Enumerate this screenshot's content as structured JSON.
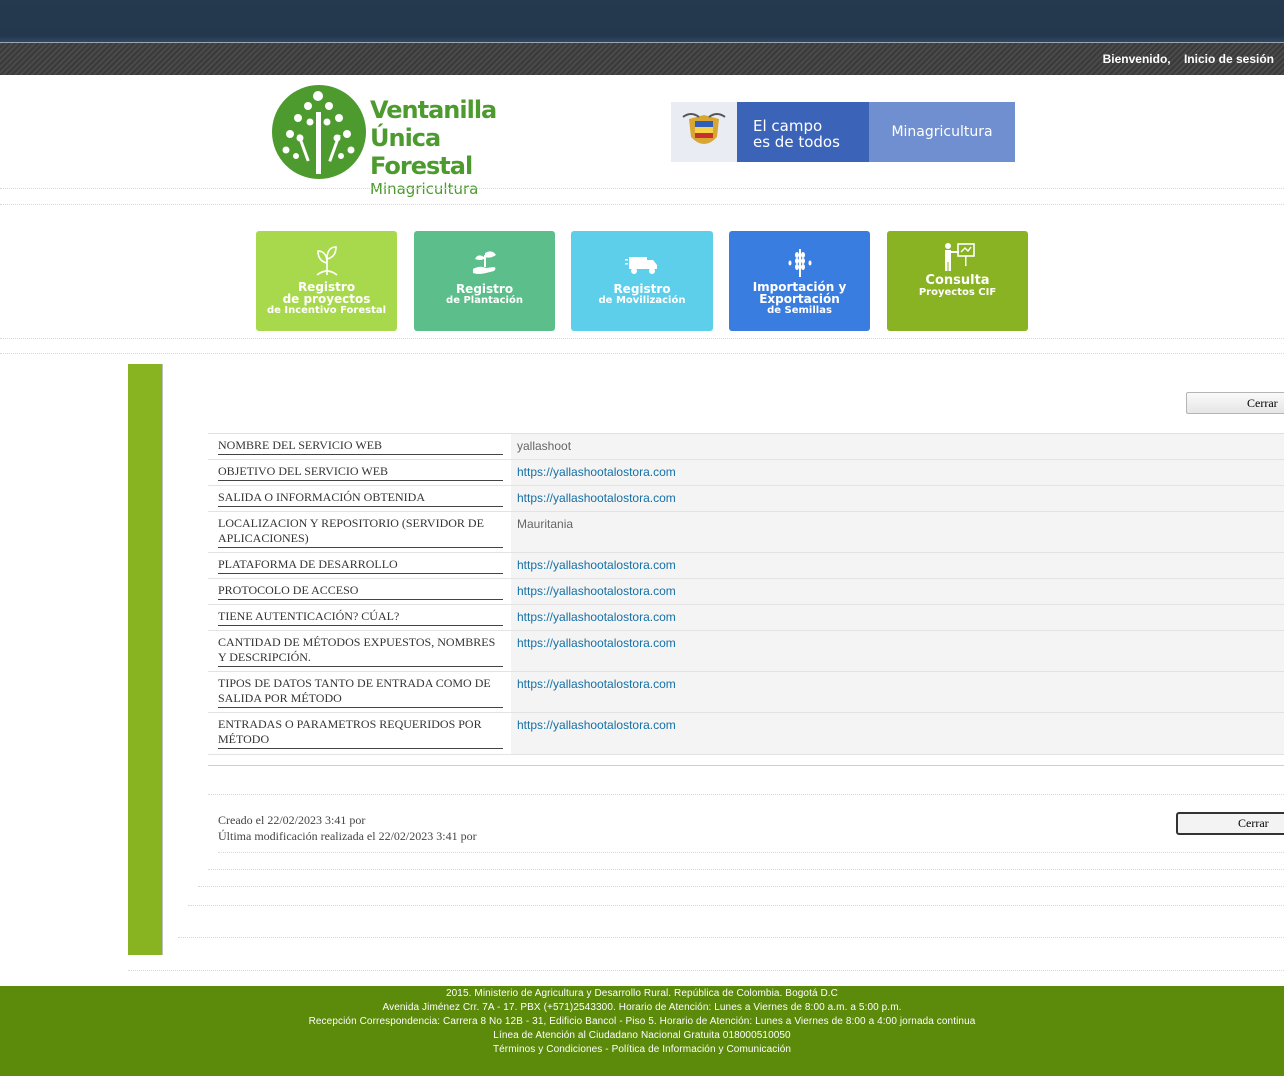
{
  "header": {
    "welcome": "Bienvenido,",
    "login": "Inicio de sesión"
  },
  "logo": {
    "line1": "Ventanilla",
    "line2": "Única Forestal",
    "line3": "Minagricultura"
  },
  "gov_banner": {
    "campo_line1": "El campo",
    "campo_line2": "es de todos",
    "ministry": "Minagricultura"
  },
  "tiles": [
    {
      "l1": "Registro",
      "l2": "de proyectos",
      "l3": "de Incentivo Forestal",
      "color": "#a8d94c"
    },
    {
      "l1": "Registro",
      "l2": "de Plantación",
      "l3": "",
      "color": "#5cbf8b"
    },
    {
      "l1": "Registro",
      "l2": "de Movilización",
      "l3": "",
      "color": "#5dcfea"
    },
    {
      "l1": "Importación y",
      "l2": "Exportación",
      "l3": "de Semillas",
      "color": "#3a7de0"
    },
    {
      "l1": "Consulta",
      "l2": "Proyectos CIF",
      "l3": "",
      "color": "#8ab324"
    }
  ],
  "buttons": {
    "close_top": "Cerrar",
    "close_bottom": "Cerrar"
  },
  "form": {
    "rows": [
      {
        "label": "NOMBRE DEL SERVICIO WEB",
        "value": "yallashoot"
      },
      {
        "label": "OBJETIVO DEL SERVICIO WEB",
        "value": "https://yallashootalostora.com"
      },
      {
        "label": "SALIDA O INFORMACIÓN OBTENIDA",
        "value": "https://yallashootalostora.com"
      },
      {
        "label": "LOCALIZACION Y REPOSITORIO (SERVIDOR DE APLICACIONES)",
        "value": "Mauritania"
      },
      {
        "label": "PLATAFORMA DE DESARROLLO",
        "value": "https://yallashootalostora.com"
      },
      {
        "label": "PROTOCOLO DE ACCESO",
        "value": "https://yallashootalostora.com"
      },
      {
        "label": "TIENE AUTENTICACIÓN? CÚAL?",
        "value": "https://yallashootalostora.com"
      },
      {
        "label": "CANTIDAD DE MÉTODOS EXPUESTOS, NOMBRES Y DESCRIPCIÓN.",
        "value": "https://yallashootalostora.com"
      },
      {
        "label": "TIPOS DE DATOS TANTO DE ENTRADA COMO DE SALIDA POR MÉTODO",
        "value": "https://yallashootalostora.com"
      },
      {
        "label": "ENTRADAS O PARAMETROS REQUERIDOS POR MÉTODO",
        "value": "https://yallashootalostora.com"
      }
    ]
  },
  "audit": {
    "created": "Creado el 22/02/2023 3:41 por",
    "modified": "Última modificación realizada el 22/02/2023 3:41 por"
  },
  "footer": {
    "line1": "2015. Ministerio de Agricultura y Desarrollo Rural. República de Colombia. Bogotá D.C",
    "line2": "Avenida Jiménez Crr. 7A - 17. PBX (+571)2543300. Horario de Atención: Lunes a Viernes de 8:00 a.m. a 5:00 p.m.",
    "line3": "Recepción Correspondencia: Carrera 8 No 12B - 31, Edificio Bancol - Piso 5. Horario de Atención: Lunes a Viernes de 8:00 a 4:00 jornada continua",
    "line4": "Línea de Atención al Ciudadano Nacional Gratuita 018000510050",
    "terms": "Términos y Condiciones",
    "sep": " - ",
    "policy": "Política de Información y Comunicación"
  }
}
